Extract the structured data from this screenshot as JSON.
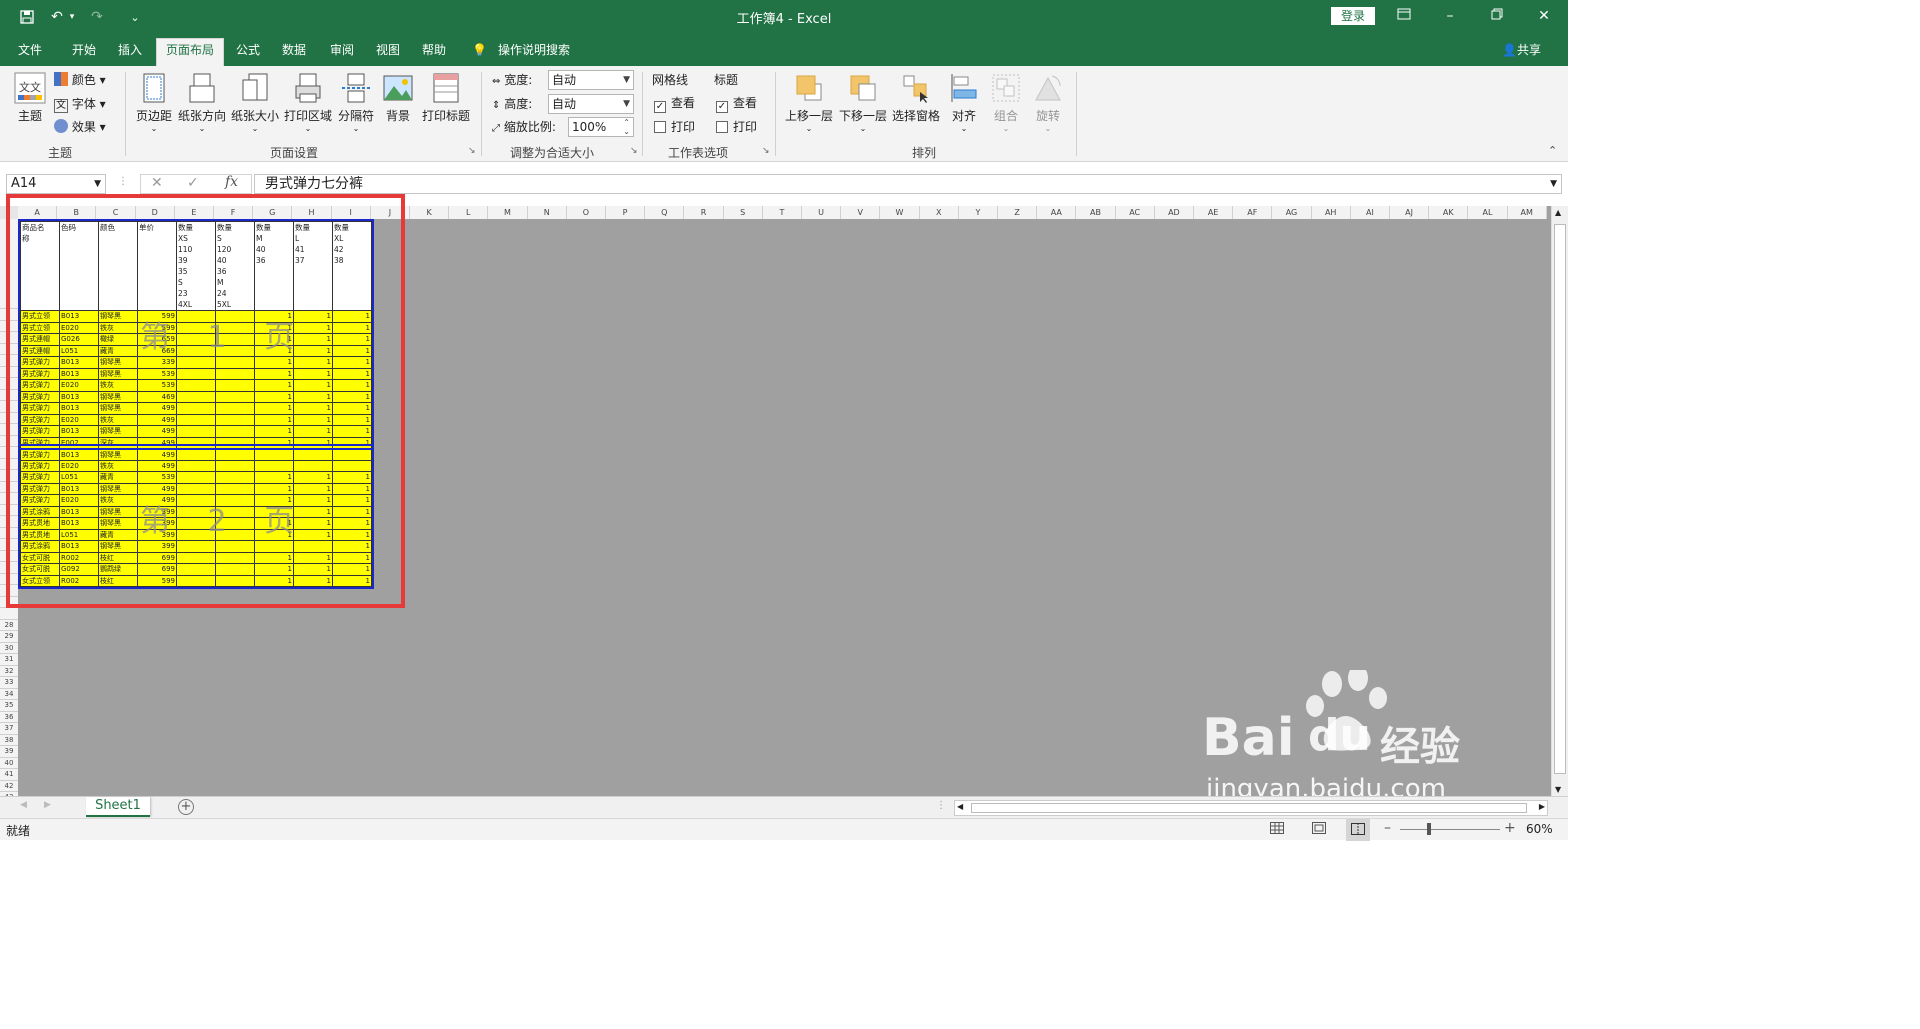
{
  "titlebar": {
    "title": "工作簿4  -  Excel",
    "login": "登录",
    "customize_glyph": "⌄"
  },
  "tabs": [
    "文件",
    "开始",
    "插入",
    "页面布局",
    "公式",
    "数据",
    "审阅",
    "视图",
    "帮助"
  ],
  "tell_me": "操作说明搜索",
  "share": "共享",
  "ribbon": {
    "themes": {
      "theme": "主题",
      "colors": "颜色",
      "fonts": "字体",
      "effects": "效果",
      "group": "主题"
    },
    "page_setup": {
      "margins": "页边距",
      "orientation": "纸张方向",
      "size": "纸张大小",
      "print_area": "打印区域",
      "breaks": "分隔符",
      "background": "背景",
      "print_titles": "打印标题",
      "group": "页面设置"
    },
    "scale": {
      "width_label": "宽度:",
      "width_value": "自动",
      "height_label": "高度:",
      "height_value": "自动",
      "scale_label": "缩放比例:",
      "scale_value": "100%",
      "group": "调整为合适大小"
    },
    "sheet_options": {
      "gridlines": "网格线",
      "headings": "标题",
      "view": "查看",
      "print": "打印",
      "group": "工作表选项"
    },
    "arrange": {
      "bring_forward": "上移一层",
      "send_backward": "下移一层",
      "selection_pane": "选择窗格",
      "align": "对齐",
      "group_btn": "组合",
      "rotate": "旋转",
      "group": "排列"
    }
  },
  "formula_bar": {
    "name_box": "A14",
    "content": "男式弹力七分裤"
  },
  "columns": [
    "A",
    "B",
    "C",
    "D",
    "E",
    "F",
    "G",
    "H",
    "I",
    "J",
    "K",
    "L",
    "M",
    "N",
    "O",
    "P",
    "Q",
    "R",
    "S",
    "T",
    "U",
    "V",
    "W",
    "X",
    "Y",
    "Z",
    "AA",
    "AB",
    "AC",
    "AD",
    "AE",
    "AF",
    "AG",
    "AH",
    "AI",
    "AJ",
    "AK",
    "AL",
    "AM"
  ],
  "row_numbers_visible": [
    "28",
    "29",
    "30",
    "31",
    "32",
    "33",
    "34",
    "35",
    "36",
    "37",
    "38",
    "39",
    "40",
    "41",
    "42",
    "43"
  ],
  "table": {
    "header": [
      "商品名\n称",
      "色码",
      "颜色",
      "单价",
      "数量\nXS\n110\n39\n35\nS\n23\n4XL",
      "数量\nS\n120\n40\n36\nM\n24\n5XL",
      "数量\nM\n40\n36",
      "数量\nL\n41\n37",
      "数量\nXL\n42\n38"
    ],
    "rows": [
      [
        "男式立领",
        "B013",
        "钢琴黑",
        "599",
        "",
        "",
        "1",
        "1",
        "1"
      ],
      [
        "男式立领",
        "E020",
        "铁灰",
        "599",
        "",
        "",
        "1",
        "1",
        "1"
      ],
      [
        "男式連帽",
        "G026",
        "橄绿",
        "659",
        "",
        "",
        "1",
        "1",
        "1"
      ],
      [
        "男式連帽",
        "L051",
        "藏青",
        "669",
        "",
        "",
        "1",
        "1",
        "1"
      ],
      [
        "男式弹力",
        "B013",
        "钢琴黑",
        "339",
        "",
        "",
        "1",
        "1",
        "1"
      ],
      [
        "男式弹力",
        "B013",
        "钢琴黑",
        "539",
        "",
        "",
        "1",
        "1",
        "1"
      ],
      [
        "男式弹力",
        "E020",
        "铁灰",
        "539",
        "",
        "",
        "1",
        "1",
        "1"
      ],
      [
        "男式弹力",
        "B013",
        "钢琴黑",
        "469",
        "",
        "",
        "1",
        "1",
        "1"
      ],
      [
        "男式弹力",
        "B013",
        "钢琴黑",
        "499",
        "",
        "",
        "1",
        "1",
        "1"
      ],
      [
        "男式弹力",
        "E020",
        "铁灰",
        "499",
        "",
        "",
        "1",
        "1",
        "1"
      ],
      [
        "男式弹力",
        "B013",
        "钢琴黑",
        "499",
        "",
        "",
        "1",
        "1",
        "1"
      ],
      [
        "男式弹力",
        "E002",
        "深灰",
        "499",
        "",
        "",
        "1",
        "1",
        "1"
      ],
      [
        "男式弹力",
        "B013",
        "钢琴黑",
        "499",
        "",
        "",
        "",
        "",
        ""
      ],
      [
        "男式弹力",
        "E020",
        "铁灰",
        "499",
        "",
        "",
        "",
        "",
        ""
      ],
      [
        "男式弹力",
        "L051",
        "藏青",
        "539",
        "",
        "",
        "1",
        "1",
        "1"
      ],
      [
        "男式弹力",
        "B013",
        "钢琴黑",
        "499",
        "",
        "",
        "1",
        "1",
        "1"
      ],
      [
        "男式弹力",
        "E020",
        "铁灰",
        "499",
        "",
        "",
        "1",
        "1",
        "1"
      ],
      [
        "男式涂鸦",
        "B013",
        "钢琴黑",
        "399",
        "",
        "",
        "",
        "1",
        "1"
      ],
      [
        "男式贯地",
        "B013",
        "钢琴黑",
        "399",
        "",
        "",
        "1",
        "1",
        "1"
      ],
      [
        "男式贯地",
        "L051",
        "藏青",
        "399",
        "",
        "",
        "1",
        "1",
        "1"
      ],
      [
        "男式涂鸦",
        "B013",
        "钢琴黑",
        "399",
        "",
        "",
        "",
        "",
        "1"
      ],
      [
        "女式可脱",
        "R002",
        "枝红",
        "699",
        "",
        "",
        "1",
        "1",
        "1"
      ],
      [
        "女式可脱",
        "G092",
        "鹦鹉绿",
        "699",
        "",
        "",
        "1",
        "1",
        "1"
      ],
      [
        "女式立领",
        "R002",
        "枝红",
        "599",
        "",
        "",
        "1",
        "1",
        "1"
      ]
    ]
  },
  "watermarks": {
    "page1": "第 1 页",
    "page2": "第 2 页"
  },
  "sheet_tab": "Sheet1",
  "status": {
    "ready": "就绪",
    "zoom": "60%"
  },
  "brand_watermark": {
    "logo": "Bai",
    "cn": "经验",
    "url": "jingyan.baidu.com"
  },
  "colors": {
    "excel_green": "#217346",
    "highlight_yellow": "#ffff00",
    "print_area_border": "#1a27c9",
    "annotation_red": "#e63a3a"
  }
}
